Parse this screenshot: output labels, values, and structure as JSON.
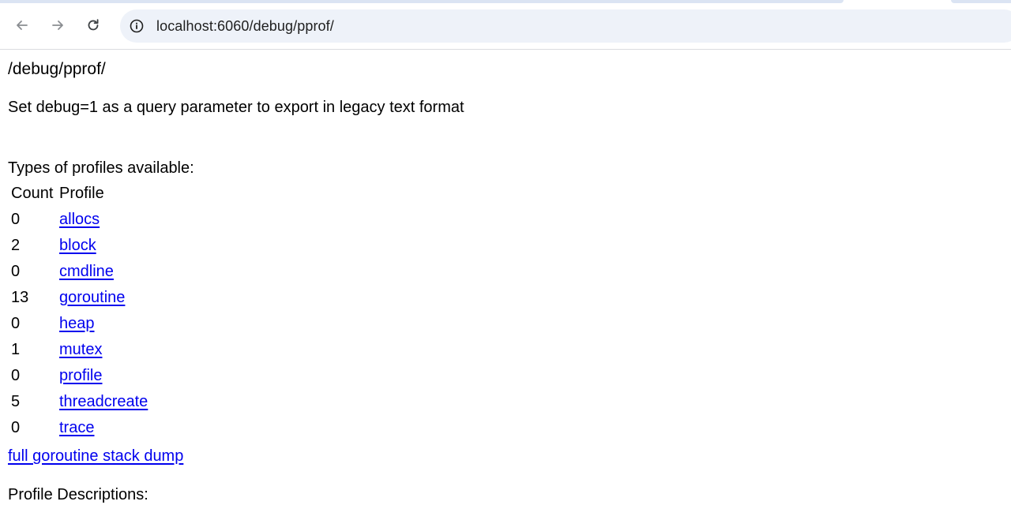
{
  "browser": {
    "url": "localhost:6060/debug/pprof/",
    "back_icon": "arrow-left-icon",
    "forward_icon": "arrow-right-icon",
    "reload_icon": "reload-icon",
    "site_info_icon": "info-circle-icon"
  },
  "page": {
    "heading": "/debug/pprof/",
    "note": "Set debug=1 as a query parameter to export in legacy text format",
    "types_label": "Types of profiles available:",
    "table": {
      "headers": [
        "Count",
        "Profile"
      ],
      "rows": [
        {
          "count": "0",
          "profile": "allocs"
        },
        {
          "count": "2",
          "profile": "block"
        },
        {
          "count": "0",
          "profile": "cmdline"
        },
        {
          "count": "13",
          "profile": "goroutine"
        },
        {
          "count": "0",
          "profile": "heap"
        },
        {
          "count": "1",
          "profile": "mutex"
        },
        {
          "count": "0",
          "profile": "profile"
        },
        {
          "count": "5",
          "profile": "threadcreate"
        },
        {
          "count": "0",
          "profile": "trace"
        }
      ]
    },
    "full_dump_link": "full goroutine stack dump",
    "descriptions_label": "Profile Descriptions:"
  },
  "colors": {
    "link": "#0000ee",
    "omnibox_bg": "#eef2f9",
    "tabstrip": "#dbe4f3"
  }
}
